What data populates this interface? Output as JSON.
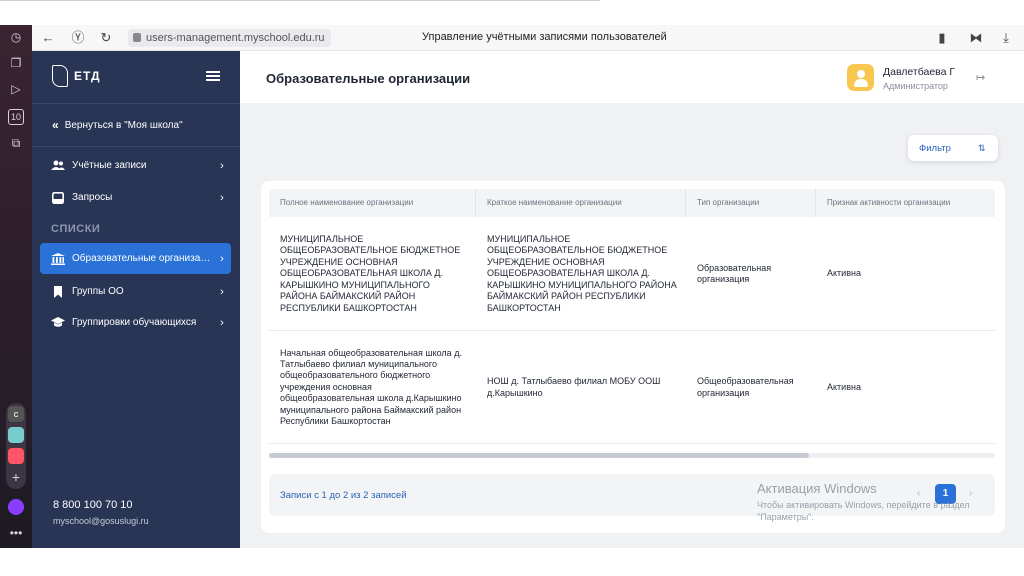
{
  "browser": {
    "url": "users-management.myschool.edu.ru",
    "tab_title": "Управление учётными записями пользователей"
  },
  "sidebar": {
    "logo_text": "ЕТД",
    "back_label": "Вернуться в \"Моя школа\"",
    "items": [
      {
        "label": "Учётные записи",
        "icon": "users-icon"
      },
      {
        "label": "Запросы",
        "icon": "inbox-icon"
      }
    ],
    "section_title": "СПИСКИ",
    "list_items": [
      {
        "label": "Образовательные организации",
        "icon": "building-icon",
        "active": true
      },
      {
        "label": "Группы ОО",
        "icon": "bookmark-icon",
        "active": false
      },
      {
        "label": "Группировки обучающихся",
        "icon": "graduation-cap-icon",
        "active": false
      }
    ],
    "phone": "8 800 100 70 10",
    "email": "myschool@gosuslugi.ru"
  },
  "header": {
    "title": "Образовательные организации",
    "user_name": "Давлетбаева Г",
    "user_role": "Администратор"
  },
  "filter_label": "Фильтр",
  "table": {
    "columns": [
      "Полное наименование организации",
      "Краткое наименование организации",
      "Тип организации",
      "Признак активности организации"
    ],
    "rows": [
      {
        "full": "МУНИЦИПАЛЬНОЕ ОБЩЕОБРАЗОВАТЕЛЬНОЕ БЮДЖЕТНОЕ УЧРЕЖДЕНИЕ ОСНОВНАЯ ОБЩЕОБРАЗОВАТЕЛЬНАЯ ШКОЛА Д. КАРЫШКИНО МУНИЦИПАЛЬНОГО РАЙОНА БАЙМАКСКИЙ РАЙОН РЕСПУБЛИКИ БАШКОРТОСТАН",
        "short": "МУНИЦИПАЛЬНОЕ ОБЩЕОБРАЗОВАТЕЛЬНОЕ БЮДЖЕТНОЕ УЧРЕЖДЕНИЕ ОСНОВНАЯ ОБЩЕОБРАЗОВАТЕЛЬНАЯ ШКОЛА Д. КАРЫШКИНО МУНИЦИПАЛЬНОГО РАЙОНА БАЙМАКСКИЙ РАЙОН РЕСПУБЛИКИ БАШКОРТОСТАН",
        "type": "Образовательная организация",
        "status": "Активна"
      },
      {
        "full": "Начальная общеобразовательная школа д. Татлыбаево филиал муниципального общеобразовательного бюджетного учреждения основная общеобразовательная школа д.Карышкино муниципального района Баймакский район Республики Башкортостан",
        "short": "НОШ д. Татлыбаево филиал МОБУ ООШ д.Карышкино",
        "type": "Общеобразовательная организация",
        "status": "Активна"
      }
    ]
  },
  "pagination": {
    "records_text": "Записи с 1 до 2 из 2 записей",
    "current_page": "1",
    "prev": "‹",
    "next": "›"
  },
  "watermark": {
    "title": "Активация Windows",
    "text": "Чтобы активировать Windows, перейдите в раздел \"Параметры\"."
  },
  "colors": {
    "sidebar_bg": "#283554",
    "accent": "#2a72d8",
    "link": "#2a62b8"
  }
}
